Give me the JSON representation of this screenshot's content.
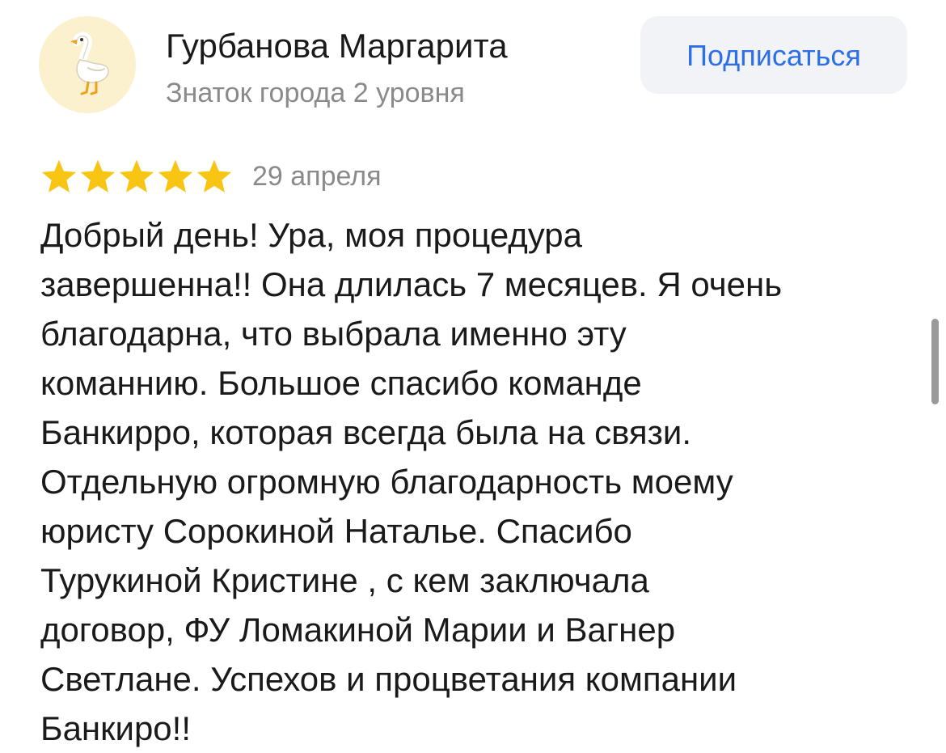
{
  "author": {
    "name": "Гурбанова Маргарита",
    "level": "Знаток города 2 уровня",
    "avatar_icon": "goose-icon"
  },
  "subscribe_button": {
    "label": "Подписаться"
  },
  "review": {
    "rating": 5,
    "rating_max": 5,
    "date": "29 апреля",
    "lines": [
      "Добрый день! Ура, моя процедура",
      "завершенна!! Она длилась 7 месяцев. Я очень",
      "благодарна, что выбрала именно эту",
      "команнию. Большое спасибо команде",
      "Банкирро, которая всегда была на связи.",
      "Отдельную огромную благодарность моему",
      "юристу Сорокиной Наталье. Спасибо",
      "Турукиной Кристине , с кем заключала",
      "договор, ФУ Ломакиной Марии и Вагнер",
      "Светлане. Успехов и процветания компании",
      "Банкиро!!"
    ]
  },
  "colors": {
    "accent": "#2d6fe6",
    "star": "#f9c513",
    "avatar_bg": "#fbf1cf",
    "muted_text": "#8a8a8a"
  }
}
